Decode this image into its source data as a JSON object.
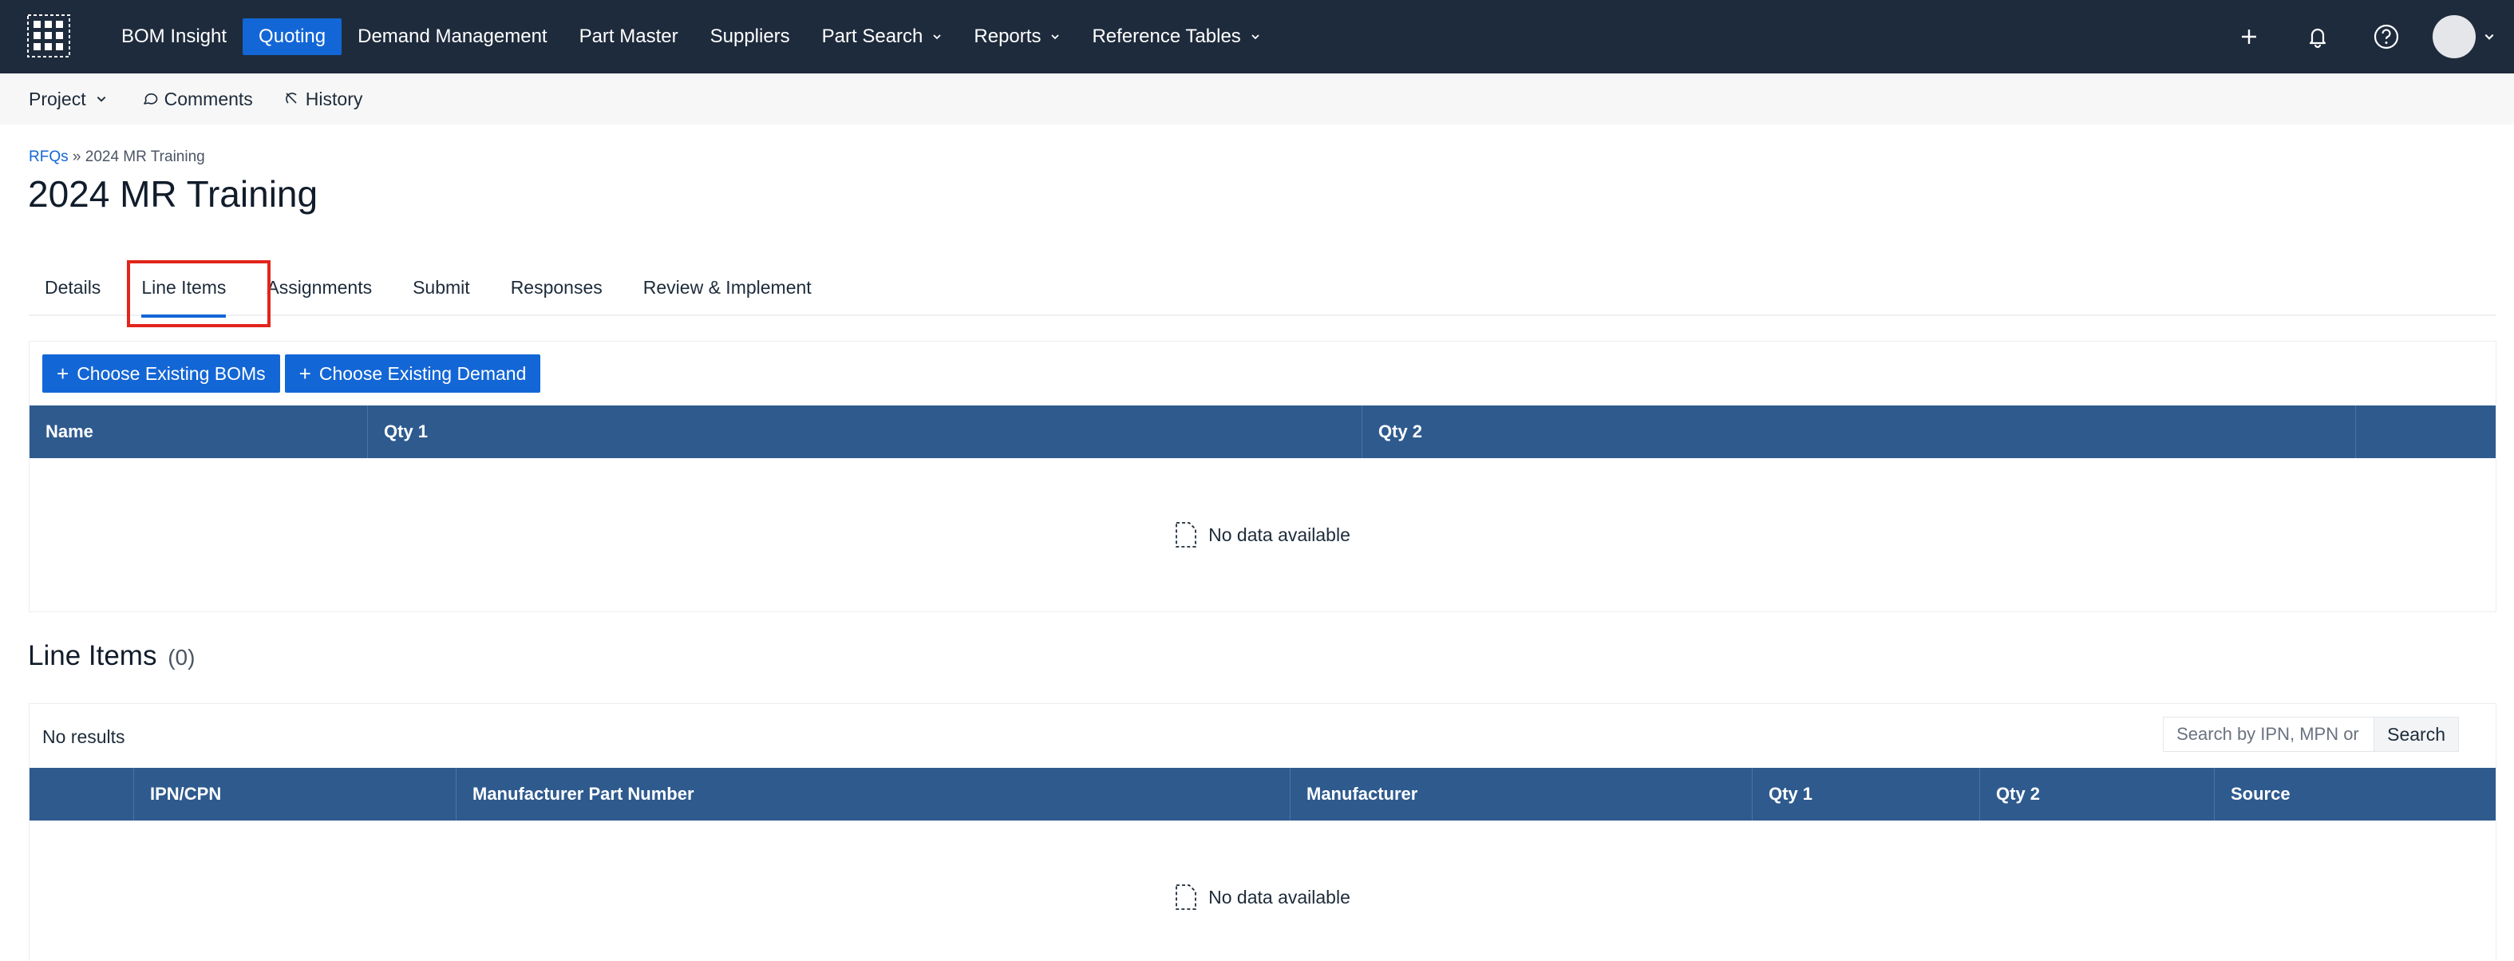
{
  "topnav": {
    "items": [
      {
        "label": "BOM Insight"
      },
      {
        "label": "Quoting",
        "active": true
      },
      {
        "label": "Demand Management"
      },
      {
        "label": "Part Master"
      },
      {
        "label": "Suppliers"
      },
      {
        "label": "Part Search",
        "dropdown": true
      },
      {
        "label": "Reports",
        "dropdown": true
      },
      {
        "label": "Reference Tables",
        "dropdown": true
      }
    ],
    "right_icons": [
      "plus-icon",
      "bell-icon",
      "help-icon"
    ],
    "accent": "#1366d6",
    "background": "#1e2b3c"
  },
  "subnav": {
    "project": "Project",
    "comments": "Comments",
    "history": "History"
  },
  "breadcrumb": {
    "root": "RFQs",
    "separator": "»",
    "current": "2024 MR Training"
  },
  "page": {
    "title": "2024 MR Training"
  },
  "tabs": {
    "items": [
      {
        "label": "Details"
      },
      {
        "label": "Line Items",
        "active": true
      },
      {
        "label": "Assignments"
      },
      {
        "label": "Submit"
      },
      {
        "label": "Responses"
      },
      {
        "label": "Review & Implement"
      }
    ],
    "highlight_color": "#e1251b"
  },
  "demand_panel": {
    "buttons": {
      "choose_boms": "Choose Existing BOMs",
      "choose_demand": "Choose Existing Demand"
    },
    "columns": [
      "Name",
      "Qty 1",
      "Qty 2",
      ""
    ],
    "empty_text": "No data available"
  },
  "line_items": {
    "title": "Line Items",
    "count": "(0)",
    "no_results": "No results",
    "search_placeholder": "Search by IPN, MPN or",
    "search_button": "Search",
    "columns": [
      "",
      "IPN/CPN",
      "Manufacturer Part Number",
      "Manufacturer",
      "Qty 1",
      "Qty 2",
      "Source"
    ],
    "empty_text": "No data available",
    "header_color": "#2e5a8e"
  }
}
